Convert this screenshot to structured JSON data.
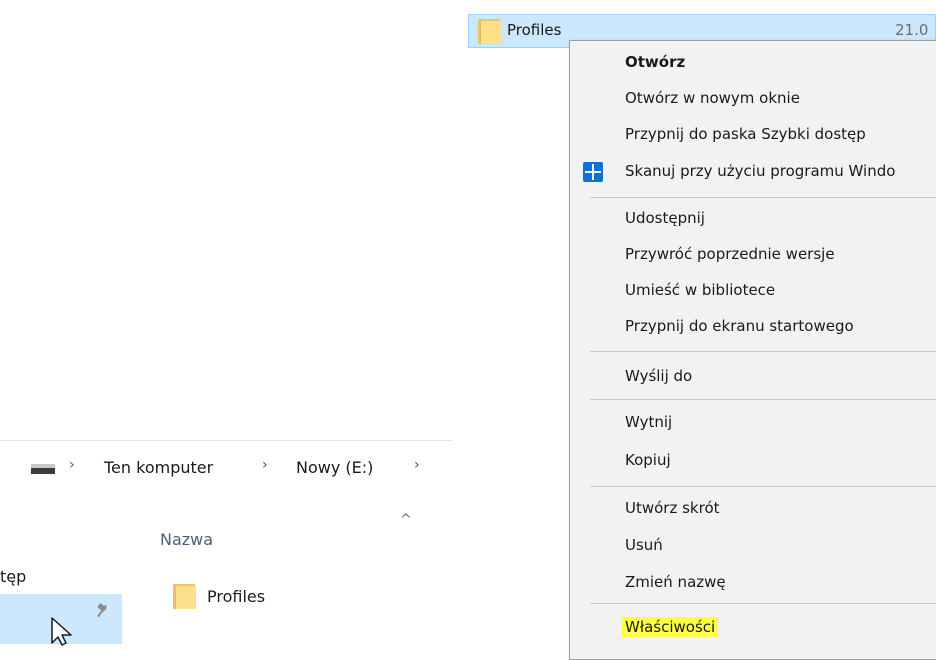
{
  "top_row": {
    "name": "Profiles",
    "date_fragment": "21.0"
  },
  "context_menu": {
    "items": [
      {
        "label": "Otwórz"
      },
      {
        "label": "Otwórz w nowym oknie"
      },
      {
        "label": "Przypnij do paska Szybki dostęp"
      },
      {
        "label": "Skanuj przy użyciu programu Windo"
      },
      {
        "label": "Udostępnij"
      },
      {
        "label": "Przywróć poprzednie wersje"
      },
      {
        "label": "Umieść w bibliotece"
      },
      {
        "label": "Przypnij do ekranu startowego"
      },
      {
        "label": "Wyślij do"
      },
      {
        "label": "Wytnij"
      },
      {
        "label": "Kopiuj"
      },
      {
        "label": "Utwórz skrót"
      },
      {
        "label": "Usuń"
      },
      {
        "label": "Zmień nazwę"
      },
      {
        "label": "Właściwości"
      }
    ],
    "highlight_color": "#ffff45"
  },
  "address_bar": {
    "crumbs": [
      "Ten komputer",
      "Nowy (E:)"
    ],
    "separator_glyph": "›"
  },
  "nav_pane": {
    "partial_label": "tęp"
  },
  "files": {
    "column_header": "Nazwa",
    "sort_glyph": "^",
    "rows": [
      {
        "name": "Profiles"
      }
    ]
  },
  "colors": {
    "selection": "#cce8ff",
    "menu_background": "#f2f2f2",
    "folder": "#ffe08a"
  }
}
